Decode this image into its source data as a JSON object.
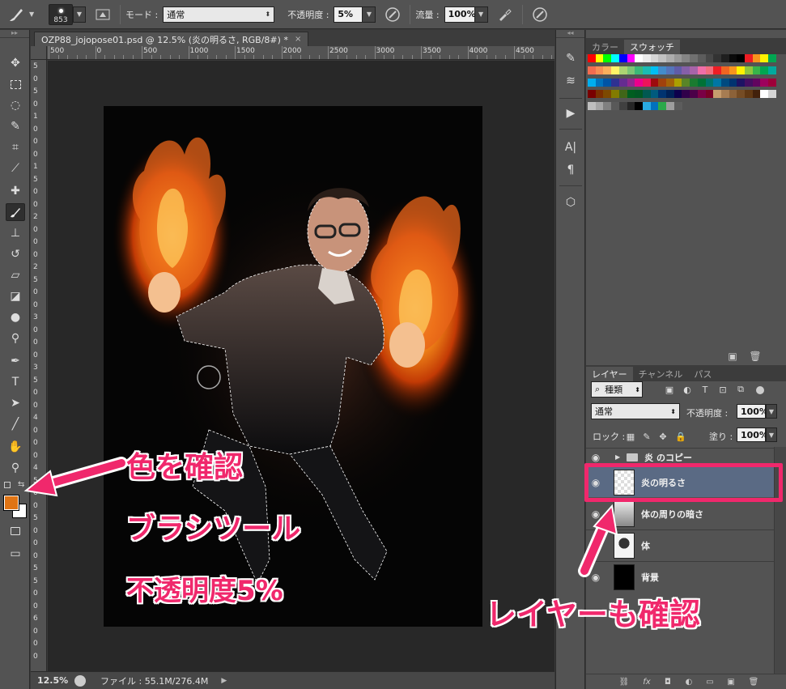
{
  "options_bar": {
    "brush_size": "853",
    "mode_label": "モード :",
    "mode_value": "通常",
    "opacity_label": "不透明度 :",
    "opacity_value": "5%",
    "flow_label": "流量 :",
    "flow_value": "100%"
  },
  "document": {
    "tab_title": "OZP88_jojopose01.psd @ 12.5% (炎の明るさ, RGB/8#) *",
    "tab_close": "×"
  },
  "ruler": {
    "top_labels": [
      "500",
      "0",
      "500",
      "1000",
      "1500",
      "2000",
      "2500",
      "3000",
      "3500",
      "4000",
      "4500"
    ],
    "left_labels": [
      "5",
      "0",
      "5",
      "0",
      "1",
      "0",
      "0",
      "0",
      "1",
      "5",
      "0",
      "0",
      "2",
      "0",
      "0",
      "0",
      "2",
      "5",
      "0",
      "0",
      "3",
      "0",
      "0",
      "0",
      "3",
      "5",
      "0",
      "0",
      "4",
      "0",
      "0",
      "0",
      "4",
      "5",
      "0",
      "0",
      "5",
      "0",
      "0",
      "0",
      "5",
      "5",
      "0",
      "0",
      "6",
      "0",
      "0",
      "0"
    ]
  },
  "status": {
    "zoom": "12.5%",
    "file_info": "ファイル : 55.1M/276.4M"
  },
  "panels": {
    "top_tabs": [
      "カラー",
      "スウォッチ"
    ],
    "layers_tabs": [
      "レイヤー",
      "チャンネル",
      "パス"
    ],
    "filter_label": "種類",
    "blend_mode": "通常",
    "opacity_label": "不透明度 :",
    "opacity_value": "100%",
    "lock_label": "ロック :",
    "fill_label": "塗り :",
    "fill_value": "100%"
  },
  "layers": [
    {
      "name": "炎 のコピー",
      "type": "group"
    },
    {
      "name": "炎の明るさ",
      "type": "layer",
      "selected": true
    },
    {
      "name": "体の周りの暗さ",
      "type": "layer"
    },
    {
      "name": "体",
      "type": "layer"
    },
    {
      "name": "背景",
      "type": "layer"
    }
  ],
  "swatch_colors": [
    [
      "#ff0000",
      "#ffff00",
      "#00ff00",
      "#00ffff",
      "#0000ff",
      "#ff00ff",
      "#ffffff",
      "#ebebeb",
      "#d6d6d6",
      "#c2c2c2",
      "#adadad",
      "#999999",
      "#858585",
      "#707070",
      "#5c5c5c",
      "#474747",
      "#333333",
      "#1f1f1f",
      "#0a0a0a",
      "#000000",
      "#ee1d24",
      "#f7941d",
      "#fff200",
      "#00a651"
    ],
    [
      "#f26c4f",
      "#f68e55",
      "#fbaf5c",
      "#fff467",
      "#acd372",
      "#7cc576",
      "#3bb878",
      "#1abbb4",
      "#00bff3",
      "#438cca",
      "#5574b9",
      "#605ca8",
      "#855fa8",
      "#a763a9",
      "#ef6ea8",
      "#f16d7e",
      "#ee1d24",
      "#f16522",
      "#f7941d",
      "#fff200",
      "#8fc63d",
      "#37b44a",
      "#00a651",
      "#00a99e"
    ],
    [
      "#00aeef",
      "#0072bc",
      "#0054a5",
      "#2e3192",
      "#652c91",
      "#91278f",
      "#ec008c",
      "#ed145a",
      "#9d0a0e",
      "#a0410d",
      "#a36209",
      "#aba000",
      "#598527",
      "#1a7b30",
      "#007236",
      "#00746b",
      "#0076a4",
      "#004a80",
      "#003370",
      "#1d1363",
      "#450e61",
      "#62055f",
      "#9e005d",
      "#9e0039"
    ],
    [
      "#790000",
      "#7b2e00",
      "#7d4900",
      "#827b00",
      "#406618",
      "#005e20",
      "#005824",
      "#005951",
      "#005b7e",
      "#003370",
      "#002157",
      "#0d004c",
      "#30004a",
      "#4b0048",
      "#7a0045",
      "#7a0026",
      "#c69c6d",
      "#a67c52",
      "#8c6239",
      "#754c24",
      "#603813",
      "#42210b",
      "#ffffff",
      "#d5d5d5"
    ],
    [
      "#bfbfbf",
      "#a6a6a6",
      "#808080",
      "#595959",
      "#404040",
      "#262626",
      "#000000",
      "#29abe2",
      "#0071bc",
      "#2ba84a",
      "#9e9e9e",
      "#5c5c5c"
    ]
  ],
  "annotations": {
    "check_color": "色を確認",
    "brush_tool": "ブラシツール",
    "opacity": "不透明度5%",
    "check_layer": "レイヤーも確認"
  },
  "colors": {
    "foreground": "#e07414",
    "background": "#ffffff",
    "annotation": "#f0286c",
    "selected_layer": "#5a6a84"
  }
}
